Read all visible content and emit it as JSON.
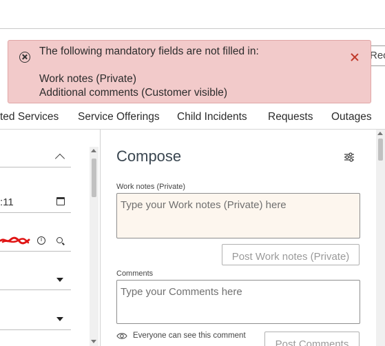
{
  "alert": {
    "heading": "The following mandatory fields are not filled in:",
    "fields": [
      "Work notes (Private)",
      "Additional comments (Customer visible)"
    ]
  },
  "partial_button": {
    "label": "Reo"
  },
  "tabs": [
    {
      "label": "ted Services"
    },
    {
      "label": "Service Offerings"
    },
    {
      "label": "Child Incidents"
    },
    {
      "label": "Requests"
    },
    {
      "label": "Outages"
    }
  ],
  "left_panel": {
    "time_value": ":11"
  },
  "compose": {
    "title": "Compose",
    "work_notes": {
      "label": "Work notes (Private)",
      "placeholder": "Type your Work notes (Private) here",
      "value": "",
      "post_button": "Post Work notes (Private)"
    },
    "comments": {
      "label": "Comments",
      "placeholder": "Type your Comments here",
      "value": "",
      "post_button": "Post Comments"
    },
    "visibility_hint": "Everyone can see this comment"
  },
  "icons": [
    "error-circle-icon",
    "close-icon",
    "chevron-up-icon",
    "calendar-icon",
    "info-icon",
    "search-icon",
    "dropdown-caret-icon",
    "settings-sliders-icon",
    "eye-icon"
  ],
  "colors": {
    "alert_bg": "#f2caca",
    "alert_close": "#c0392b",
    "work_notes_bg": "#fdf6ee",
    "title": "#3a4650"
  }
}
